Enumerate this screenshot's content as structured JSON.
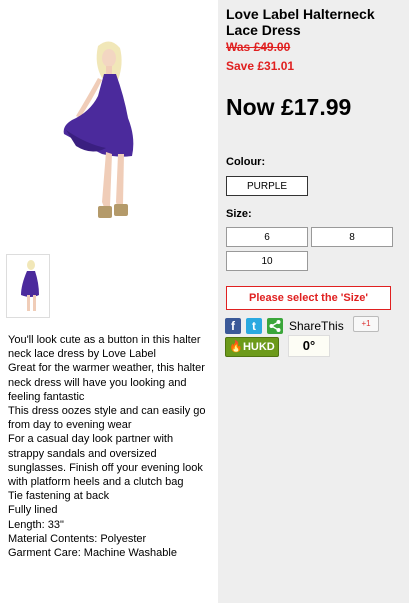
{
  "product": {
    "title": "Love Label Halterneck Lace Dress",
    "was_price": "Was £49.00",
    "save_amount": "Save £31.01",
    "now_price": "Now £17.99"
  },
  "colour": {
    "label": "Colour:",
    "options": [
      "PURPLE"
    ]
  },
  "size": {
    "label": "Size:",
    "options": [
      "6",
      "8",
      "10"
    ]
  },
  "error_message": "Please select the 'Size'",
  "share": {
    "facebook_icon": "f",
    "twitter_icon": "t",
    "label": "ShareThis",
    "gplus_label": "+1"
  },
  "hukd": {
    "label": "HUKD",
    "temperature": "0°"
  },
  "description": [
    "You'll look cute as a button in this halter neck lace dress by Love Label",
    "Great for the warmer weather, this halter neck dress will have you looking and feeling fantastic",
    "This dress oozes style and can easily go from day to evening wear",
    "For a casual day look partner with strappy sandals and oversized sunglasses. Finish off your evening look with platform heels and a clutch bag",
    "Tie fastening at back",
    "Fully lined",
    "Length: 33\"",
    "Material Contents: Polyester",
    "Garment Care: Machine Washable"
  ],
  "colors": {
    "dress_purple": "#4b2a9c",
    "price_red": "#e02020",
    "panel_bg": "#eeeeee",
    "hukd_green": "#6c9a1a"
  }
}
